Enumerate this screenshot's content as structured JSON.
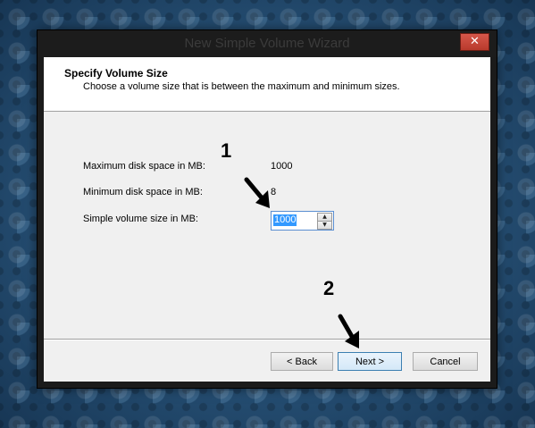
{
  "window": {
    "title": "New Simple Volume Wizard",
    "close_glyph": "✕"
  },
  "header": {
    "title": "Specify Volume Size",
    "subtitle": "Choose a volume size that is between the maximum and minimum sizes."
  },
  "fields": {
    "max_label": "Maximum disk space in MB:",
    "max_value": "1000",
    "min_label": "Minimum disk space in MB:",
    "min_value": "8",
    "size_label": "Simple volume size in MB:",
    "size_value": "1000"
  },
  "buttons": {
    "back": "< Back",
    "next": "Next >",
    "cancel": "Cancel"
  },
  "annotations": {
    "step1": "1",
    "step2": "2"
  },
  "icons": {
    "spin_up": "▲",
    "spin_down": "▼"
  }
}
